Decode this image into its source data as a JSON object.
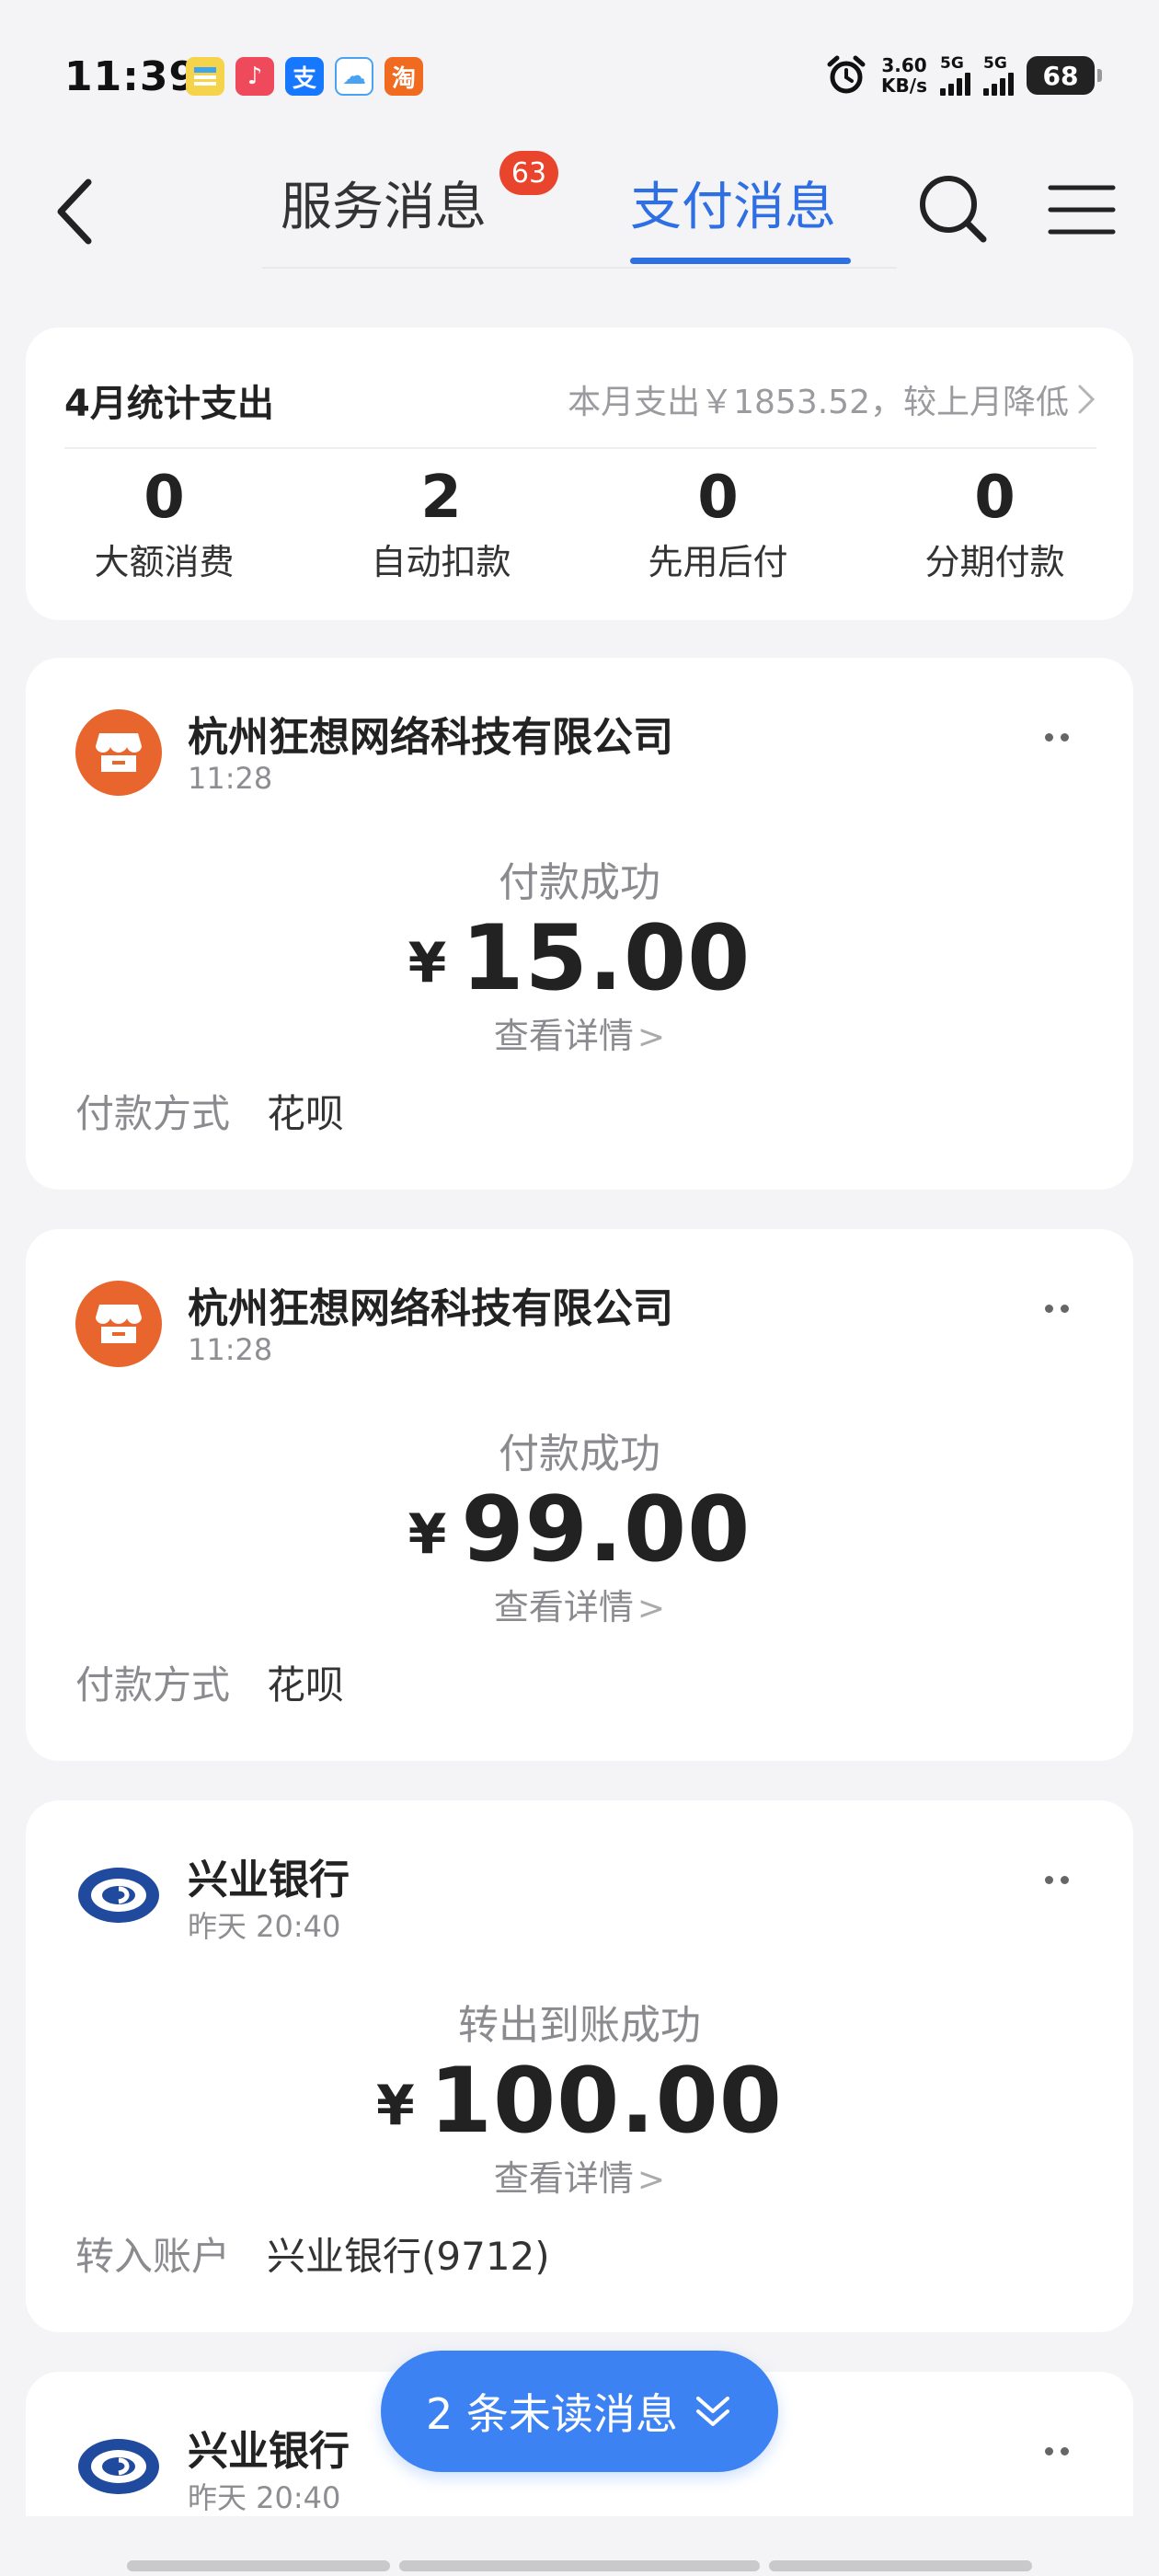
{
  "status_bar": {
    "time": "11:39",
    "apps": [
      {
        "icon": "notes-app-icon",
        "color": "#f5d34b",
        "glyph": ""
      },
      {
        "icon": "music-app-icon",
        "color": "#ef4a5b",
        "glyph": "♪"
      },
      {
        "icon": "alipay-app-icon",
        "color": "#1677ff",
        "glyph": "支"
      },
      {
        "icon": "baidu-netdisk-app-icon",
        "color": "#4aa3f2",
        "glyph": "☁"
      },
      {
        "icon": "taobao-app-icon",
        "color": "#f06a1f",
        "glyph": "淘"
      }
    ],
    "speed_value": "3.60",
    "speed_unit": "KB/s",
    "net1": "5G",
    "net2": "5G",
    "battery": "68"
  },
  "nav": {
    "tab_service": "服务消息",
    "tab_service_badge": "63",
    "tab_pay": "支付消息",
    "active_tab": "支付消息"
  },
  "summary": {
    "title": "4月统计支出",
    "note": "本月支出￥1853.52，较上月降低",
    "stats": [
      {
        "value": "0",
        "label": "大额消费"
      },
      {
        "value": "2",
        "label": "自动扣款"
      },
      {
        "value": "0",
        "label": "先用后付"
      },
      {
        "value": "0",
        "label": "分期付款"
      }
    ]
  },
  "messages": [
    {
      "merchant": "杭州狂想网络科技有限公司",
      "time": "11:28",
      "avatar": "shop-icon",
      "status": "付款成功",
      "currency": "¥",
      "amount": "15.00",
      "detail": "查看详情",
      "field_label": "付款方式",
      "field_value": "花呗"
    },
    {
      "merchant": "杭州狂想网络科技有限公司",
      "time": "11:28",
      "avatar": "shop-icon",
      "status": "付款成功",
      "currency": "¥",
      "amount": "99.00",
      "detail": "查看详情",
      "field_label": "付款方式",
      "field_value": "花呗"
    },
    {
      "merchant": "兴业银行",
      "time": "昨天 20:40",
      "avatar": "cib-bank-logo-icon",
      "status": "转出到账成功",
      "currency": "¥",
      "amount": "100.00",
      "detail": "查看详情",
      "field_label": "转入账户",
      "field_value": "兴业银行(9712)"
    },
    {
      "merchant": "兴业银行",
      "time": "昨天 20:40",
      "avatar": "cib-bank-logo-icon"
    }
  ],
  "unread_pill": {
    "label": "2 条未读消息"
  },
  "colors": {
    "accent": "#2f6fe4",
    "badge": "#e8452c",
    "shop_avatar": "#e8652e",
    "bank_logo": "#1f4a9e",
    "pill": "#3d82f2"
  }
}
